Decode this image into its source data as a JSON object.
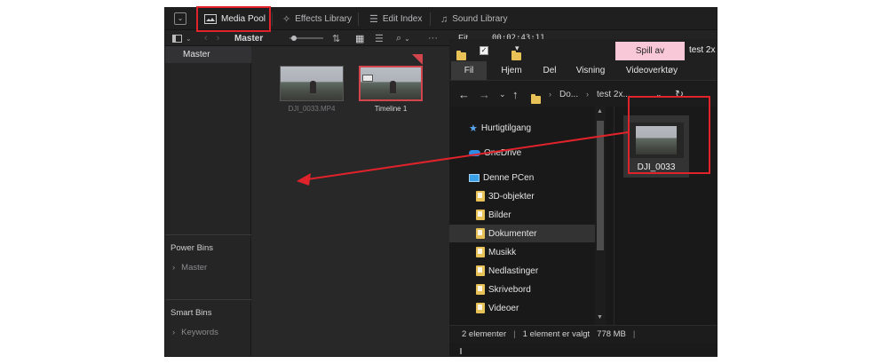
{
  "topbar": {
    "tabs": [
      {
        "label": "Media Pool",
        "icon": "media-pool-icon"
      },
      {
        "label": "Effects Library",
        "icon": "effects-library-icon"
      },
      {
        "label": "Edit Index",
        "icon": "edit-index-icon"
      },
      {
        "label": "Sound Library",
        "icon": "sound-library-icon"
      }
    ]
  },
  "toolbar2": {
    "bin": "Master",
    "zoom_mode": "Fit",
    "timecode": "00:02:43:11"
  },
  "leftpanel": {
    "master": "Master",
    "power_bins": {
      "title": "Power Bins",
      "item": "Master"
    },
    "smart_bins": {
      "title": "Smart Bins",
      "item": "Keywords"
    }
  },
  "media": [
    {
      "label": "DJI_0033.MP4"
    },
    {
      "label": "Timeline 1"
    }
  ],
  "explorer": {
    "title_button": "Spill av",
    "title_text": "test 2x",
    "ribbon": [
      "Fil",
      "Hjem",
      "Del",
      "Visning",
      "Videoverktøy"
    ],
    "address": [
      "Do...",
      "test 2x..."
    ],
    "nav": [
      {
        "label": "Hurtigtilgang",
        "icon": "star-icon"
      },
      {
        "label": "OneDrive",
        "icon": "cloud-icon"
      },
      {
        "label": "Denne PCen",
        "icon": "computer-icon"
      },
      {
        "label": "3D-objekter",
        "icon": "folder-icon"
      },
      {
        "label": "Bilder",
        "icon": "folder-icon"
      },
      {
        "label": "Dokumenter",
        "icon": "folder-icon"
      },
      {
        "label": "Musikk",
        "icon": "folder-icon"
      },
      {
        "label": "Nedlastinger",
        "icon": "folder-icon"
      },
      {
        "label": "Skrivebord",
        "icon": "folder-icon"
      },
      {
        "label": "Videoer",
        "icon": "folder-icon"
      }
    ],
    "file": {
      "label": "DJI_0033"
    },
    "status": {
      "count": "2 elementer",
      "selected": "1 element er valgt",
      "size": "778 MB"
    }
  },
  "colors": {
    "annotation": "#e0232b",
    "accent_pink": "#f8c8d8"
  }
}
